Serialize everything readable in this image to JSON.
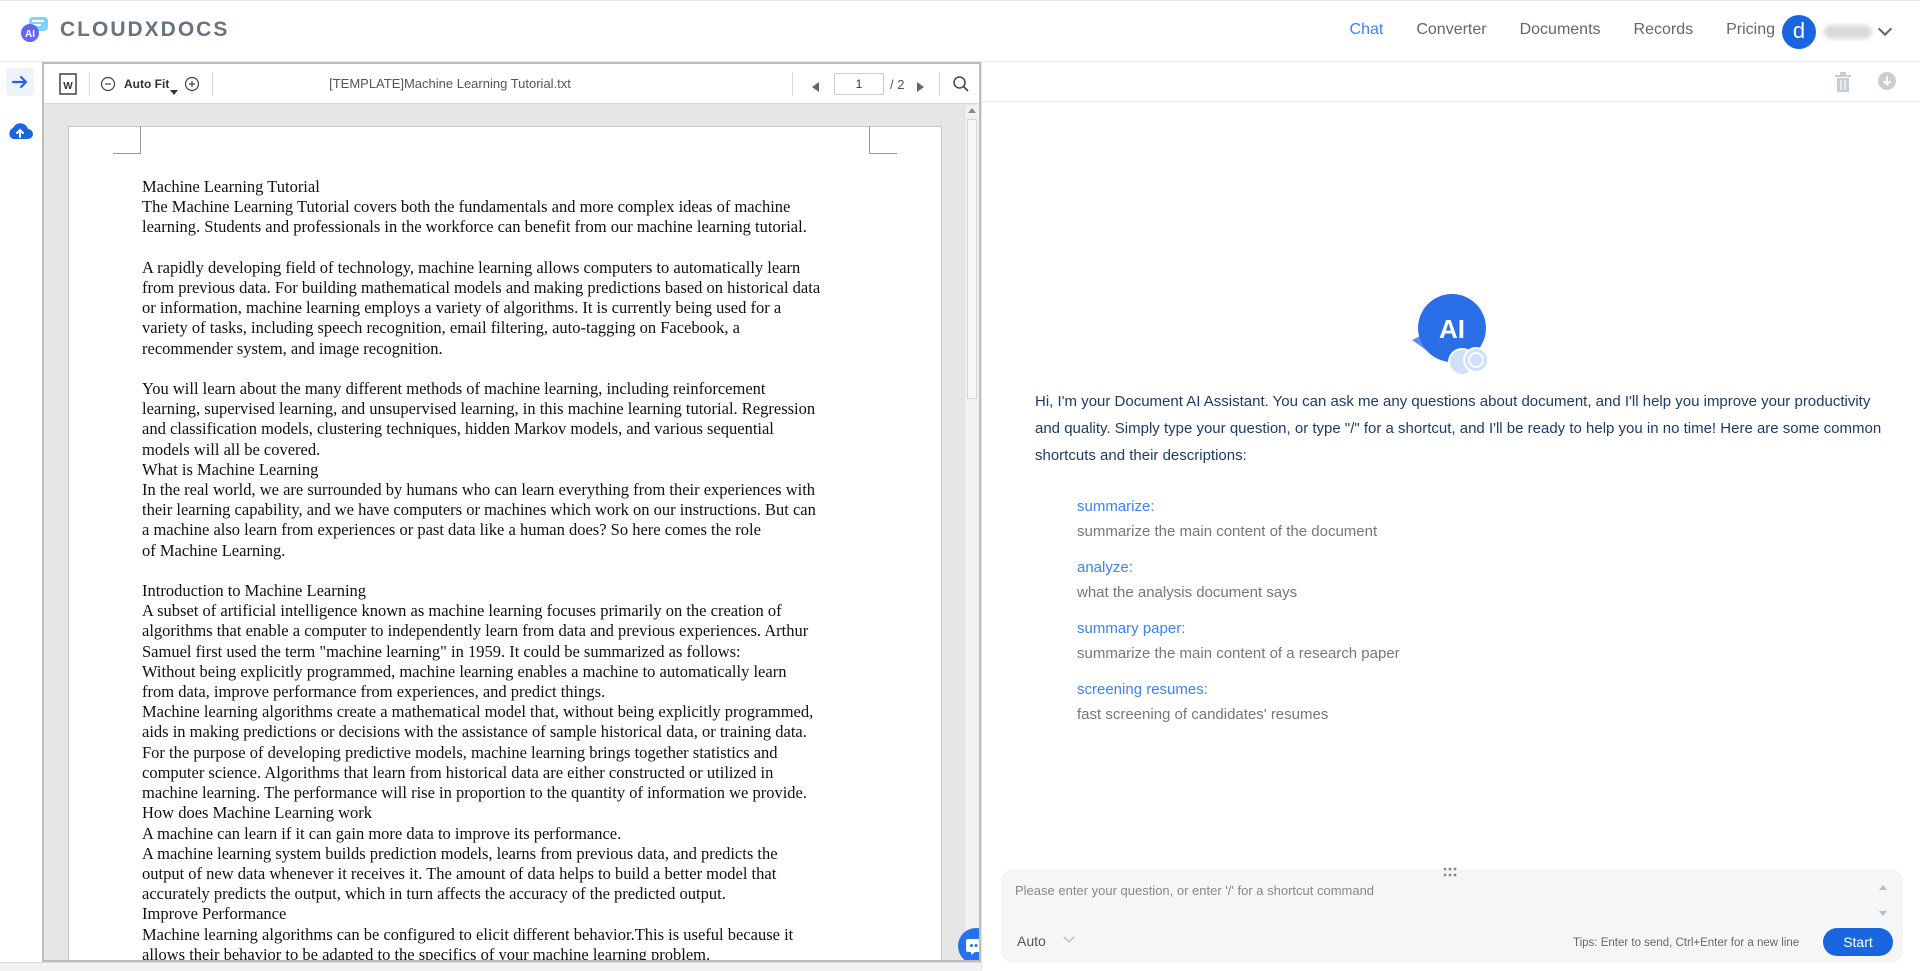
{
  "brand": {
    "name": "CLOUDXDOCS",
    "logo_icon": "ai-chat-logo"
  },
  "nav": {
    "items": [
      {
        "label": "Chat",
        "active": true
      },
      {
        "label": "Converter",
        "active": false
      },
      {
        "label": "Documents",
        "active": false
      },
      {
        "label": "Records",
        "active": false
      },
      {
        "label": "Pricing",
        "active": false
      }
    ],
    "user_initial": "d"
  },
  "rail": {
    "expand_icon": "arrow-right-icon",
    "upload_icon": "cloud-upload-icon"
  },
  "viewer": {
    "file_icon": "word-file-icon",
    "zoom_label": "Auto Fit",
    "title": "[TEMPLATE]Machine Learning Tutorial.txt",
    "page_current": "1",
    "page_total": "/ 2",
    "search_icon": "search-icon",
    "text": "Machine Learning Tutorial\nThe Machine Learning Tutorial covers both the fundamentals and more complex ideas of machine\nlearning. Students and professionals in the workforce can benefit from our machine learning tutorial.\n\nA rapidly developing field of technology, machine learning allows computers to automatically learn\nfrom previous data. For building mathematical models and making predictions based on historical data\nor information, machine learning employs a variety of algorithms. It is currently being used for a\nvariety of tasks, including speech recognition, email filtering, auto-tagging on Facebook, a\nrecommender system, and image recognition.\n\nYou will learn about the many different methods of machine learning, including reinforcement\nlearning, supervised learning, and unsupervised learning, in this machine learning tutorial. Regression\nand classification models, clustering techniques, hidden Markov models, and various sequential\nmodels will all be covered.\nWhat is Machine Learning\nIn the real world, we are surrounded by humans who can learn everything from their experiences with\ntheir learning capability, and we have computers or machines which work on our instructions. But can\na machine also learn from experiences or past data like a human does? So here comes the role\nof Machine Learning.\n\nIntroduction to Machine Learning\nA subset of artificial intelligence known as machine learning focuses primarily on the creation of\nalgorithms that enable a computer to independently learn from data and previous experiences. Arthur\nSamuel first used the term \"machine learning\" in 1959. It could be summarized as follows:\nWithout being explicitly programmed, machine learning enables a machine to automatically learn\nfrom data, improve performance from experiences, and predict things.\nMachine learning algorithms create a mathematical model that, without being explicitly programmed,\naids in making predictions or decisions with the assistance of sample historical data, or training data.\nFor the purpose of developing predictive models, machine learning brings together statistics and\ncomputer science. Algorithms that learn from historical data are either constructed or utilized in\nmachine learning. The performance will rise in proportion to the quantity of information we provide.\nHow does Machine Learning work\nA machine can learn if it can gain more data to improve its performance.\nA machine learning system builds prediction models, learns from previous data, and predicts the\noutput of new data whenever it receives it. The amount of data helps to build a better model that\naccurately predicts the output, which in turn affects the accuracy of the predicted output.\nImprove Performance\nMachine learning algorithms can be configured to elicit different behavior.This is useful because it\nallows their behavior to be adapted to the specifics of your machine learning problem."
  },
  "chat": {
    "header_icons": [
      "trash-icon",
      "download-icon"
    ],
    "intro": "Hi, I'm your Document AI Assistant. You can ask me any questions about document, and I'll help you improve your productivity and quality. Simply type your question, or type \"/\" for a shortcut, and I'll be ready to help you in no time! Here are some common shortcuts and their descriptions:",
    "shortcuts": [
      {
        "name": "summarize:",
        "desc": "summarize the main content of the document"
      },
      {
        "name": "analyze:",
        "desc": "what the analysis document says"
      },
      {
        "name": "summary paper:",
        "desc": "summarize the main content of a research paper"
      },
      {
        "name": "screening resumes:",
        "desc": "fast screening of candidates' resumes"
      }
    ],
    "input_placeholder": "Please enter your question, or enter '/' for a shortcut command",
    "mode": "Auto",
    "tips": "Tips: Enter to send, Ctrl+Enter for a new line",
    "start_label": "Start"
  },
  "colors": {
    "accent": "#1a66e0",
    "link": "#3b82f6",
    "intro_text": "#1e3a6b"
  }
}
